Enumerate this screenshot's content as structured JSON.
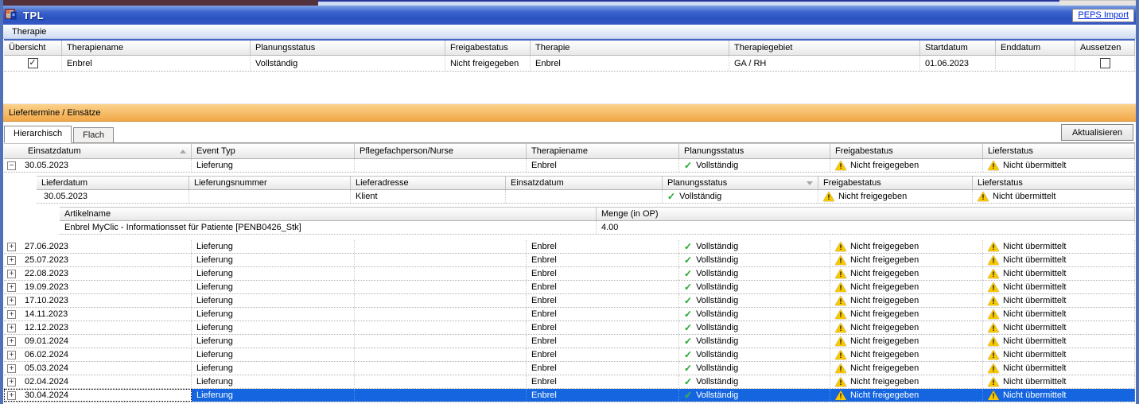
{
  "colors": {
    "titlebar_blue": "#2f56c3",
    "window_border_blue": "#5070b8",
    "section_orange": "#f2a848",
    "selection_blue": "#1565e0",
    "ok_green": "#2fa836",
    "warn_yellow": "#f8c800",
    "link_blue": "#0026d8"
  },
  "titlebar": {
    "title": "TPL",
    "peps_button": "PEPS Import"
  },
  "menubar": {
    "items": [
      "Therapie"
    ]
  },
  "therapy": {
    "columns": [
      "Übersicht",
      "Therapiename",
      "Planungsstatus",
      "Freigabestatus",
      "Therapie",
      "Therapiegebiet",
      "Startdatum",
      "Enddatum",
      "Aussetzen"
    ],
    "row": {
      "uebersicht_checked": true,
      "check_glyph": "✓",
      "therapiename": "Enbrel",
      "planungsstatus": "Vollständig",
      "freigabestatus": "Nicht freigegeben",
      "therapie": "Enbrel",
      "therapiegebiet": "GA / RH",
      "startdatum": "01.06.2023",
      "enddatum": "",
      "aussetzen_checked": false
    }
  },
  "delivery": {
    "section_title": "Liefertermine / Einsätze",
    "tabs": {
      "hierarchisch": "Hierarchisch",
      "flach": "Flach",
      "active": "Hierarchisch"
    },
    "refresh_button": "Aktualisieren",
    "columns": [
      "Einsatzdatum",
      "Event Typ",
      "Pflegefachperson/Nurse",
      "Therapiename",
      "Planungsstatus",
      "Freigabestatus",
      "Lieferstatus"
    ],
    "sort": {
      "column": "Einsatzdatum",
      "direction": "ascending"
    },
    "shared": {
      "event_typ": "Lieferung",
      "therapiename": "Enbrel",
      "planungsstatus": "Vollständig",
      "freigabestatus": "Nicht freigegeben",
      "lieferstatus": "Nicht übermittelt",
      "check_glyph": "✓"
    },
    "expanded_row": {
      "einsatzdatum": "30.05.2023"
    },
    "nested": {
      "columns": [
        "Lieferdatum",
        "Lieferungsnummer",
        "Lieferadresse",
        "Einsatzdatum",
        "Planungsstatus",
        "Freigabestatus",
        "Lieferstatus"
      ],
      "sort": {
        "column": "Planungsstatus",
        "direction": "descending"
      },
      "row": {
        "lieferdatum": "30.05.2023",
        "lieferungsnummer": "",
        "lieferadresse": "Klient",
        "einsatzdatum": "",
        "planungsstatus": "Vollständig",
        "freigabestatus": "Nicht freigegeben",
        "lieferstatus": "Nicht übermittelt"
      }
    },
    "articles": {
      "columns": [
        "Artikelname",
        "Menge (in OP)"
      ],
      "row": {
        "artikelname": "Enbrel MyClic - Informationsset für Patiente [PENB0426_Stk]",
        "menge": "4.00"
      }
    },
    "rows": [
      {
        "einsatzdatum": "27.06.2023",
        "selected": false
      },
      {
        "einsatzdatum": "25.07.2023",
        "selected": false
      },
      {
        "einsatzdatum": "22.08.2023",
        "selected": false
      },
      {
        "einsatzdatum": "19.09.2023",
        "selected": false
      },
      {
        "einsatzdatum": "17.10.2023",
        "selected": false
      },
      {
        "einsatzdatum": "14.11.2023",
        "selected": false
      },
      {
        "einsatzdatum": "12.12.2023",
        "selected": false
      },
      {
        "einsatzdatum": "09.01.2024",
        "selected": false
      },
      {
        "einsatzdatum": "06.02.2024",
        "selected": false
      },
      {
        "einsatzdatum": "05.03.2024",
        "selected": false
      },
      {
        "einsatzdatum": "02.04.2024",
        "selected": false
      },
      {
        "einsatzdatum": "30.04.2024",
        "selected": true
      }
    ]
  }
}
